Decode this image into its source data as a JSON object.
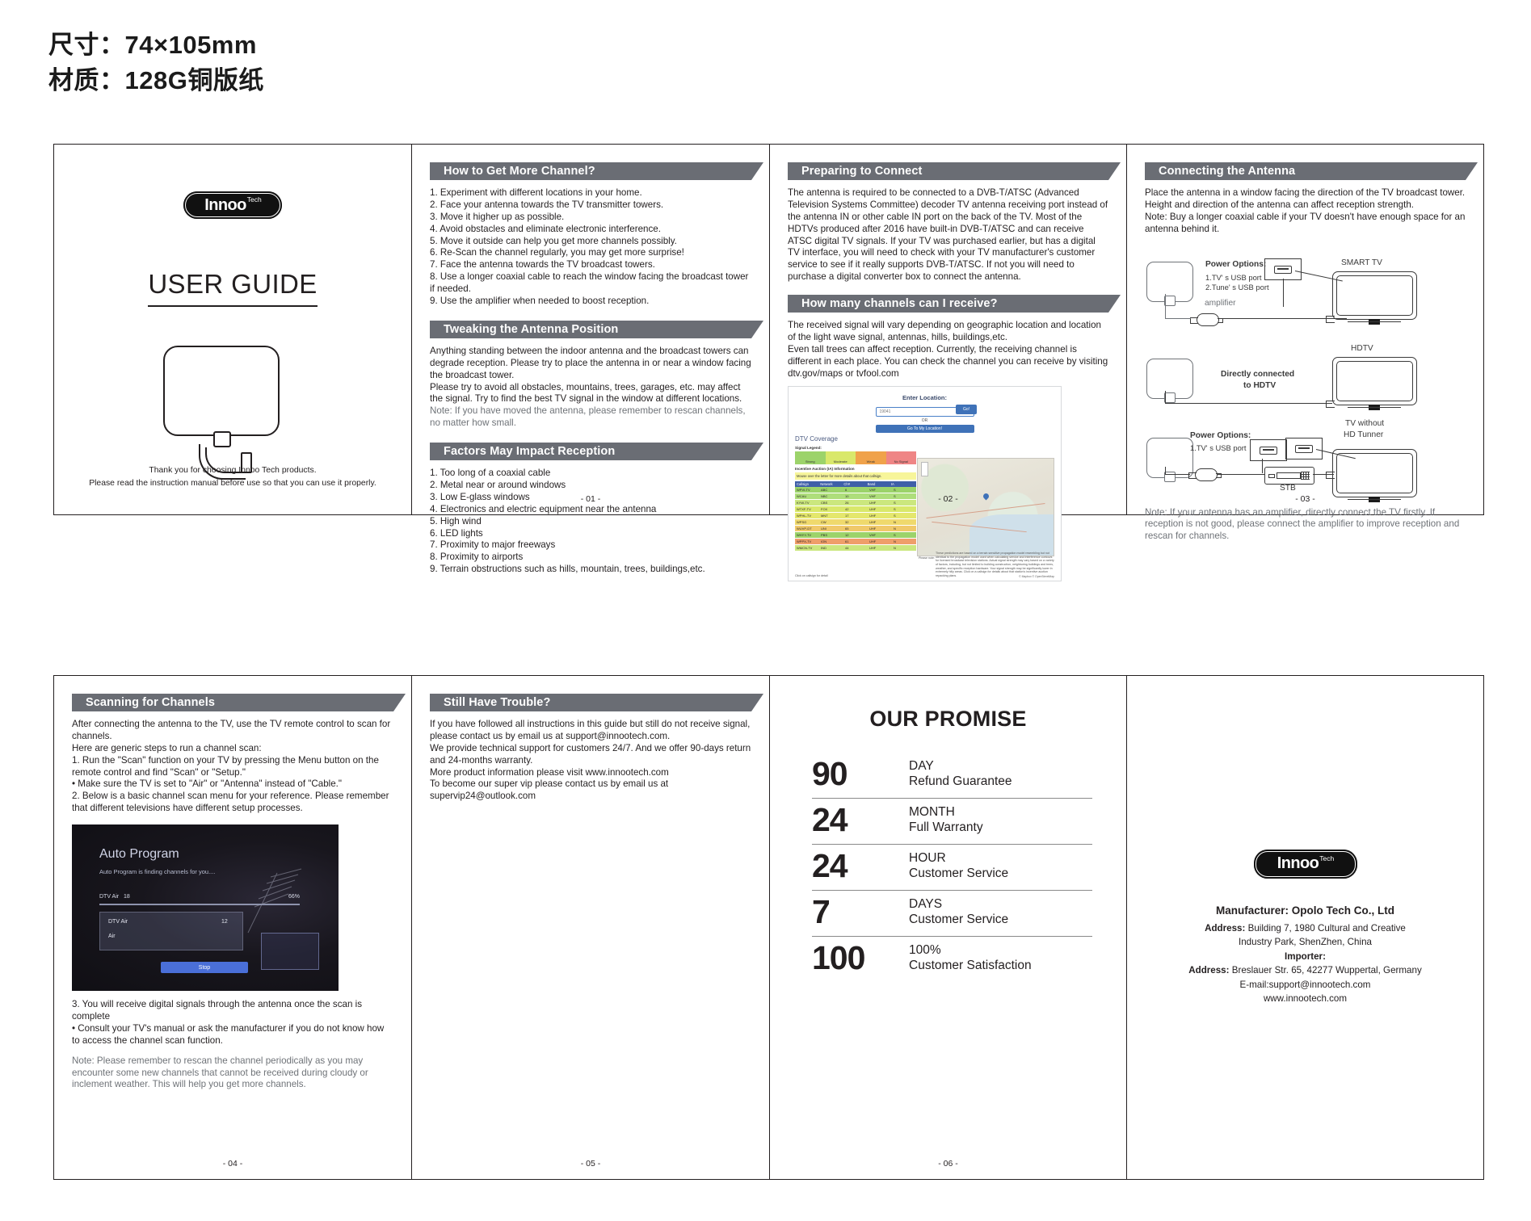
{
  "spec": {
    "size_line": "尺寸：74×105mm",
    "material_line": "材质：128G铜版纸"
  },
  "brand": {
    "name": "Innoo",
    "sup": "Tech"
  },
  "cover": {
    "title": "USER GUIDE",
    "thanks_line1": "Thank you for choosing Innoo Tech products.",
    "thanks_line2": "Please read the instruction manual before use so that you can use it properly."
  },
  "page1": {
    "page_no": "- 01 -",
    "sections": [
      {
        "heading": "How to Get More Channel?",
        "items": [
          "1. Experiment with different locations in your home.",
          "2. Face your antenna towards the TV transmitter towers.",
          "3. Move it higher up as possible.",
          "4. Avoid obstacles and eliminate electronic interference.",
          "5. Move it outside can help you get more channels possibly.",
          "6. Re-Scan the channel regularly, you may get more surprise!",
          "7. Face the antenna towards the TV broadcast towers.",
          "8. Use a longer coaxial cable to reach the window facing the broadcast tower if needed.",
          "9. Use the amplifier when needed to boost reception."
        ]
      },
      {
        "heading": "Tweaking the Antenna Position",
        "paragraphs": [
          "Anything standing between the indoor antenna and the broadcast towers can degrade reception. Please try to place the antenna in or near a window facing the broadcast tower.",
          "Please try to avoid all obstacles, mountains, trees, garages, etc. may affect the signal. Try to find the best TV signal in the window at different locations."
        ],
        "note": "Note: If you have moved the antenna, please remember to rescan channels, no matter how small."
      },
      {
        "heading": "Factors May Impact Reception",
        "items": [
          "1. Too long of a coaxial cable",
          "2. Metal near or around windows",
          "3. Low E-glass windows",
          "4. Electronics and electric equipment near the antenna",
          "5. High wind",
          "6. LED lights",
          "7. Proximity to major freeways",
          "8. Proximity to airports",
          "9. Terrain obstructions such as hills, mountain, trees, buildings,etc."
        ]
      }
    ]
  },
  "page2": {
    "page_no": "- 02 -",
    "prepare": {
      "heading": "Preparing to Connect",
      "body": "The antenna is required to be connected to a DVB-T/ATSC (Advanced Television Systems Committee) decoder TV antenna receiving port instead of the antenna IN or other cable IN port on the back of the TV. Most of the HDTVs produced after 2016 have built-in DVB-T/ATSC and can receive ATSC digital TV signals. If your TV was purchased earlier, but has a digital TV interface, you will need to check with your TV manufacturer's customer service to see if it really supports DVB-T/ATSC. If not you will need to purchase a digital converter box to connect the antenna."
    },
    "channels": {
      "heading": "How many channels can I receive?",
      "body1": "The received signal will vary depending on geographic location and location of the light wave signal, antennas, hills, buildings,etc.",
      "body2": "Even tall trees can affect reception. Currently, the receiving channel is different in each place. You can check the channel you can receive by visiting dtv.gov/maps or tvfool.com"
    },
    "screenshot": {
      "enter_location": "Enter Location:",
      "input_value": "19041",
      "go_button": "Go!",
      "or_label": "OR",
      "locate_button": "Go To My Location!",
      "coverage_title": "DTV Coverage",
      "signal_legend_label": "Signal Legend:",
      "legend": [
        "Strong",
        "Moderate",
        "Weak",
        "No Signal"
      ],
      "auction_label": "Incentive Auction (IA) Information",
      "auction_note": "Mouse over the letter for more details about that callsign.",
      "table_headers": [
        "Callsign",
        "Network",
        "Ch#",
        "Band",
        "IA"
      ],
      "table_rows": [
        [
          "WPVI-TV",
          "ABC",
          "6",
          "VHF",
          "S"
        ],
        [
          "WCAU",
          "NBC",
          "10",
          "VHF",
          "S"
        ],
        [
          "KYW-TV",
          "CBS",
          "26",
          "UHF",
          "S"
        ],
        [
          "WTXF-TV",
          "FOX",
          "42",
          "UHF",
          "S"
        ],
        [
          "WPHL-TV",
          "MNT",
          "17",
          "UHF",
          "S"
        ],
        [
          "WPSG",
          "CW",
          "32",
          "UHF",
          "N"
        ],
        [
          "WUVP-DT",
          "UNI",
          "65",
          "UHF",
          "N"
        ],
        [
          "WHYY-TV",
          "PBS",
          "12",
          "VHF",
          "S"
        ],
        [
          "WPPX-TV",
          "ION",
          "61",
          "UHF",
          "N"
        ],
        [
          "WMCN-TV",
          "IND",
          "44",
          "UHF",
          "N"
        ]
      ],
      "click_note": "Click on callsign for detail",
      "please_note": "Please note:",
      "disclaimer": "These predictions are based on a terrain sensitive propagation model resembling but not identical to the propagation model used when calculating service and interference contours for licensed broadcast television stations. Actual signal strength may vary based on a variety of factors, including, but not limited to building construction, neighboring buildings and trees, weather, and specific reception hardware. Your signal strength may be significantly lower in extremely hilly areas. Click on a callsign for details about that station's incentive auction repacking plans.",
      "map_credit": "© Mapbox © OpenStreetMap"
    }
  },
  "page3": {
    "page_no": "- 03 -",
    "heading": "Connecting the Antenna",
    "body": [
      "Place the antenna in a window facing the direction of the TV broadcast tower.",
      "Height and direction of the antenna can affect reception strength.",
      "Note: Buy a longer coaxial cable if your TV doesn't have enough space for an antenna behind it."
    ],
    "diagram": {
      "power_options_title": "Power Options:",
      "power_option_1": "1.TV' s USB port",
      "power_option_2": "2.Tune' s USB port",
      "amplifier_label": "amplifier",
      "smart_tv_label": "SMART TV",
      "hdtv_label": "HDTV",
      "direct_label_line1": "Directly connected",
      "direct_label_line2": "to HDTV",
      "tv_without_line1": "TV without",
      "tv_without_line2": "HD Tunner",
      "stb_label": "STB",
      "power_options_title2": "Power Options:",
      "power_option_3": "1.TV' s USB port"
    },
    "note": "Note: If your antenna has an amplifier, directly connect the TV firstly. If reception is not good, please connect the amplifier to improve reception and rescan for channels."
  },
  "page4": {
    "page_no": "- 04 -",
    "heading": "Scanning for Channels",
    "body": [
      "After connecting the antenna to the TV, use the TV remote control to scan for channels.",
      "Here are generic steps to run a channel scan:",
      "1. Run the \"Scan\" function on your TV by pressing the Menu button on the remote control and find \"Scan\" or \"Setup.\"",
      "• Make sure the TV is set to \"Air\" or \"Antenna\" instead of \"Cable.\"",
      "2. Below is a basic channel scan menu for your reference. Please remember that different televisions have different setup processes."
    ],
    "tv_screen": {
      "title": "Auto Program",
      "subtitle": "Auto Program is finding channels for you....",
      "row_label": "DTV Air",
      "row_value": "18",
      "percent": "66%",
      "list_item_1": "DTV Air",
      "list_item_1_val": "12",
      "list_item_2": "Air",
      "stop_button": "Stop"
    },
    "after": [
      "3. You will receive digital signals through the antenna once the scan is complete",
      "• Consult your TV's manual or ask the manufacturer if you do not know how to access the channel scan function."
    ],
    "note": "Note: Please remember to rescan the channel periodically as you may encounter some new channels that cannot be received during cloudy or inclement weather. This will help you get more channels."
  },
  "page5": {
    "page_no": "- 05 -",
    "heading": "Still Have Trouble?",
    "paragraphs": [
      "If you have followed all instructions in this guide but still do not receive signal, please contact us by email us at support@innootech.com.",
      "We provide technical support for customers 24/7. And we offer 90-days return and 24-months warranty.",
      "More product information please visit www.innootech.com",
      "To become our super vip please contact us by email us at supervip24@outlook.com"
    ]
  },
  "page6": {
    "page_no": "- 06 -",
    "title": "OUR PROMISE",
    "rows": [
      {
        "num": "90",
        "line1": "DAY",
        "line2": "Refund Guarantee"
      },
      {
        "num": "24",
        "line1": "MONTH",
        "line2": "Full Warranty"
      },
      {
        "num": "24",
        "line1": "HOUR",
        "line2": "Customer Service"
      },
      {
        "num": "7",
        "line1": "DAYS",
        "line2": "Customer Service"
      },
      {
        "num": "100",
        "line1": "100%",
        "line2": "Customer Satisfaction"
      }
    ]
  },
  "back": {
    "manufacturer": "Manufacturer: Opolo Tech Co., Ltd",
    "address_label": "Address:",
    "address_line1": "Building 7, 1980 Cultural and Creative",
    "address_line2": "Industry Park, ShenZhen, China",
    "importer_label": "Importer:",
    "importer_address_label": "Address:",
    "importer_address": "Breslauer Str. 65, 42277 Wuppertal, Germany",
    "email": "E-mail:support@innootech.com",
    "website": "www.innootech.com"
  },
  "colors": {
    "ribbon": "#6a6d74",
    "ink": "#231f20",
    "muted": "#6f7378",
    "accent_blue": "#3f72b8"
  }
}
